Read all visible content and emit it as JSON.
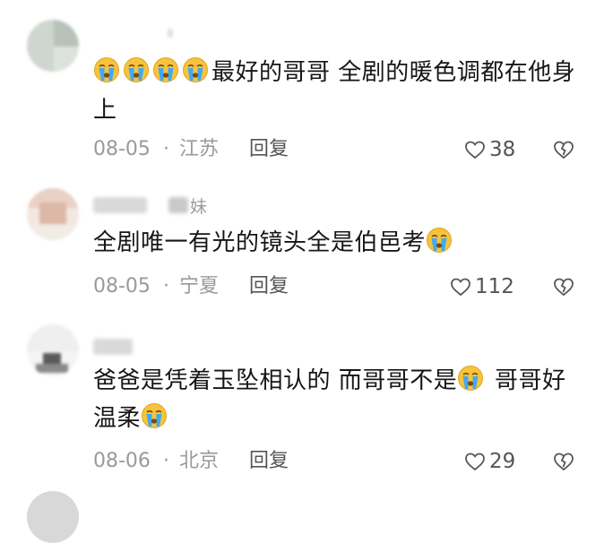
{
  "comments": [
    {
      "username": "",
      "text_segments": [
        {
          "type": "emoji",
          "icon": "crying-emoji"
        },
        {
          "type": "emoji",
          "icon": "crying-emoji"
        },
        {
          "type": "emoji",
          "icon": "crying-emoji"
        },
        {
          "type": "emoji",
          "icon": "crying-emoji"
        },
        {
          "type": "text",
          "value": "最好的哥哥 全剧的暖色调都在他身上"
        }
      ],
      "date": "08-05",
      "separator": "·",
      "location": "江苏",
      "reply_label": "回复",
      "likes": "38"
    },
    {
      "username": "妹",
      "text_segments": [
        {
          "type": "text",
          "value": "全剧唯一有光的镜头全是伯邑考"
        },
        {
          "type": "emoji",
          "icon": "crying-emoji"
        }
      ],
      "date": "08-05",
      "separator": "·",
      "location": "宁夏",
      "reply_label": "回复",
      "likes": "112"
    },
    {
      "username": "",
      "text_segments": [
        {
          "type": "text",
          "value": "爸爸是凭着玉坠相认的 而哥哥不是"
        },
        {
          "type": "emoji",
          "icon": "crying-emoji"
        },
        {
          "type": "text",
          "value": " 哥哥好温柔"
        },
        {
          "type": "emoji",
          "icon": "crying-emoji"
        }
      ],
      "date": "08-06",
      "separator": "·",
      "location": "北京",
      "reply_label": "回复",
      "likes": "29"
    }
  ],
  "colors": {
    "meta_text": "#9a9a9a",
    "body_text": "#161616",
    "emoji_face": "#f7c33c",
    "emoji_tears": "#3fa9f5"
  },
  "icons": {
    "like": "heart-outline-icon",
    "dislike": "broken-heart-icon"
  }
}
